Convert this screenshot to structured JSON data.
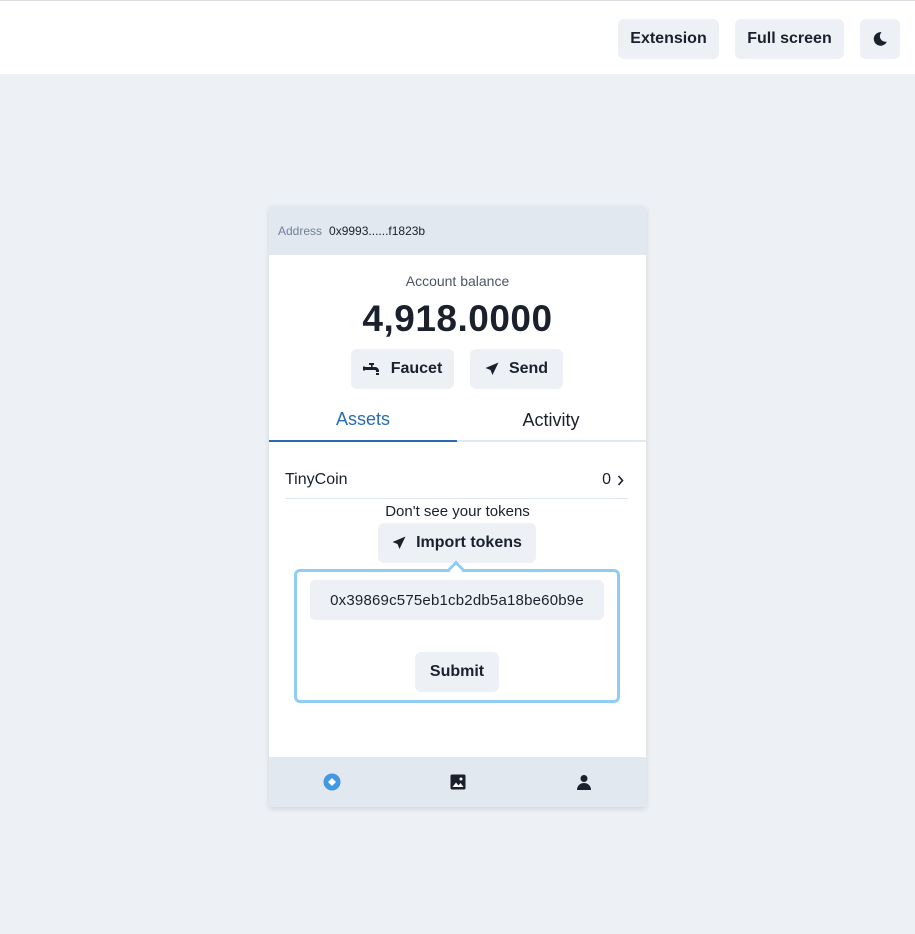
{
  "header": {
    "extension_label": "Extension",
    "fullscreen_label": "Full screen",
    "theme_icon": "moon-icon"
  },
  "wallet": {
    "address_label": "Address",
    "address_value": "0x9993......f1823b",
    "balance_label": "Account balance",
    "balance_value": "4,918.0000",
    "faucet_label": "Faucet",
    "send_label": "Send",
    "tabs": [
      {
        "label": "Assets",
        "active": true
      },
      {
        "label": "Activity",
        "active": false
      }
    ],
    "assets": [
      {
        "name": "TinyCoin",
        "amount": "0"
      }
    ],
    "no_tokens_text": "Don't see your tokens",
    "import_label": "Import tokens",
    "token_address_value": "0x39869c575eb1cb2db5a18be60b9e",
    "submit_label": "Submit",
    "nav": [
      {
        "icon": "wallet-icon",
        "active": true
      },
      {
        "icon": "image-icon",
        "active": false
      },
      {
        "icon": "user-icon",
        "active": false
      }
    ]
  },
  "colors": {
    "accent": "#2b6cb0",
    "nav_active": "#4299e1",
    "popover_border": "#90cdf4",
    "background": "#edf1f5"
  }
}
